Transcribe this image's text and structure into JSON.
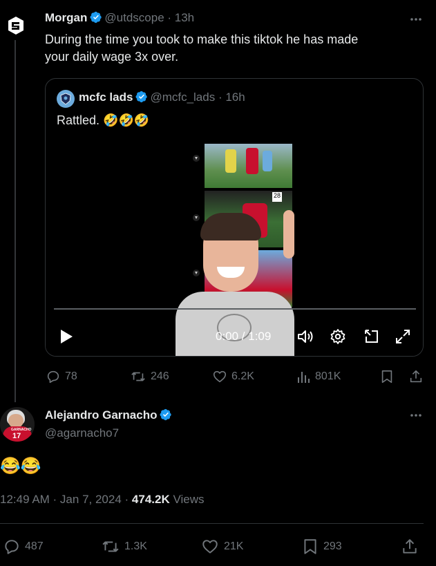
{
  "tweet1": {
    "name": "Morgan",
    "handle": "@utdscope",
    "time": "13h",
    "text_line1": "During the time you took to make this tiktok he has made",
    "text_line2": "your daily wage 3x over.",
    "more_icon": "more-horizontal-icon",
    "quote": {
      "name": "mcfc lads",
      "handle": "@mcfc_lads",
      "time": "16h",
      "text": "Rattled. 🤣🤣🤣",
      "video_time": "0:00 / 1:09"
    },
    "stats": {
      "replies": "78",
      "reposts": "246",
      "likes": "6.2K",
      "views": "801K"
    }
  },
  "tweet2": {
    "name": "Alejandro Garnacho",
    "handle": "@agarnacho7",
    "jersey": "17",
    "jersey_name": "GARNACHO",
    "text": "😂😂",
    "timestamp": "12:49 AM · Jan 7, 2024 · ",
    "views_count": "474.2K",
    "views_label": " Views",
    "stats": {
      "replies": "487",
      "reposts": "1.3K",
      "likes": "21K",
      "bookmarks": "293"
    }
  },
  "colors": {
    "background": "#000000",
    "text": "#e7e9ea",
    "secondary": "#71767b",
    "verified": "#1d9bf0",
    "border": "#2f3336"
  }
}
